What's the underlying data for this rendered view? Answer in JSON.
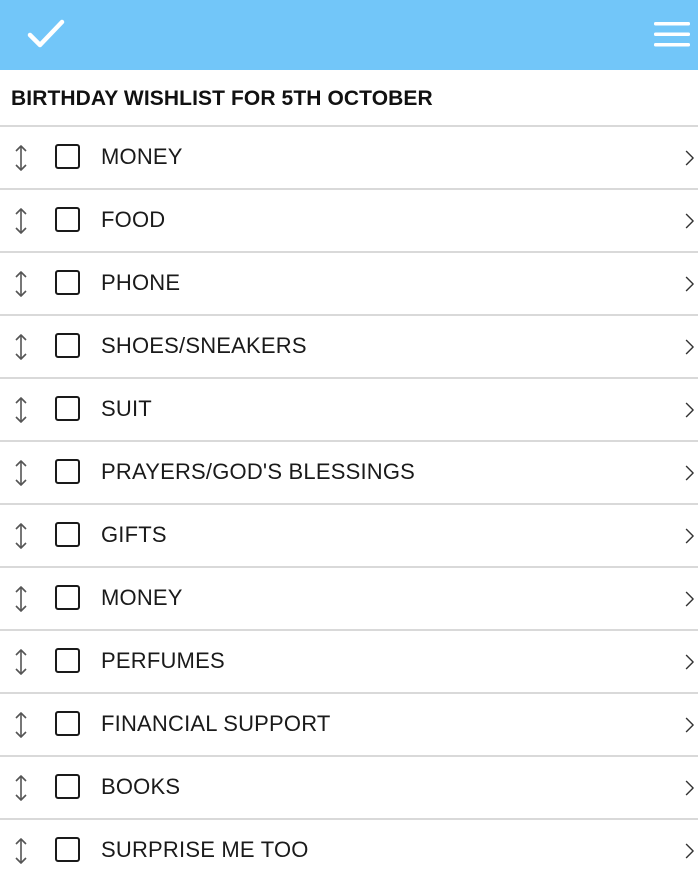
{
  "header": {
    "background": "#72c6f9",
    "left_icon": "check-icon",
    "right_icon": "hamburger-menu-icon"
  },
  "list": {
    "title": "BIRTHDAY WISHLIST FOR 5TH OCTOBER",
    "items": [
      {
        "label": "MONEY",
        "checked": false
      },
      {
        "label": "FOOD",
        "checked": false
      },
      {
        "label": "PHONE",
        "checked": false
      },
      {
        "label": "SHOES/SNEAKERS",
        "checked": false
      },
      {
        "label": "SUIT",
        "checked": false
      },
      {
        "label": "PRAYERS/GOD'S BLESSINGS",
        "checked": false
      },
      {
        "label": "GIFTS",
        "checked": false
      },
      {
        "label": "MONEY",
        "checked": false
      },
      {
        "label": "PERFUMES",
        "checked": false
      },
      {
        "label": "FINANCIAL SUPPORT",
        "checked": false
      },
      {
        "label": "BOOKS",
        "checked": false
      },
      {
        "label": "SURPRISE ME TOO",
        "checked": false
      }
    ]
  }
}
